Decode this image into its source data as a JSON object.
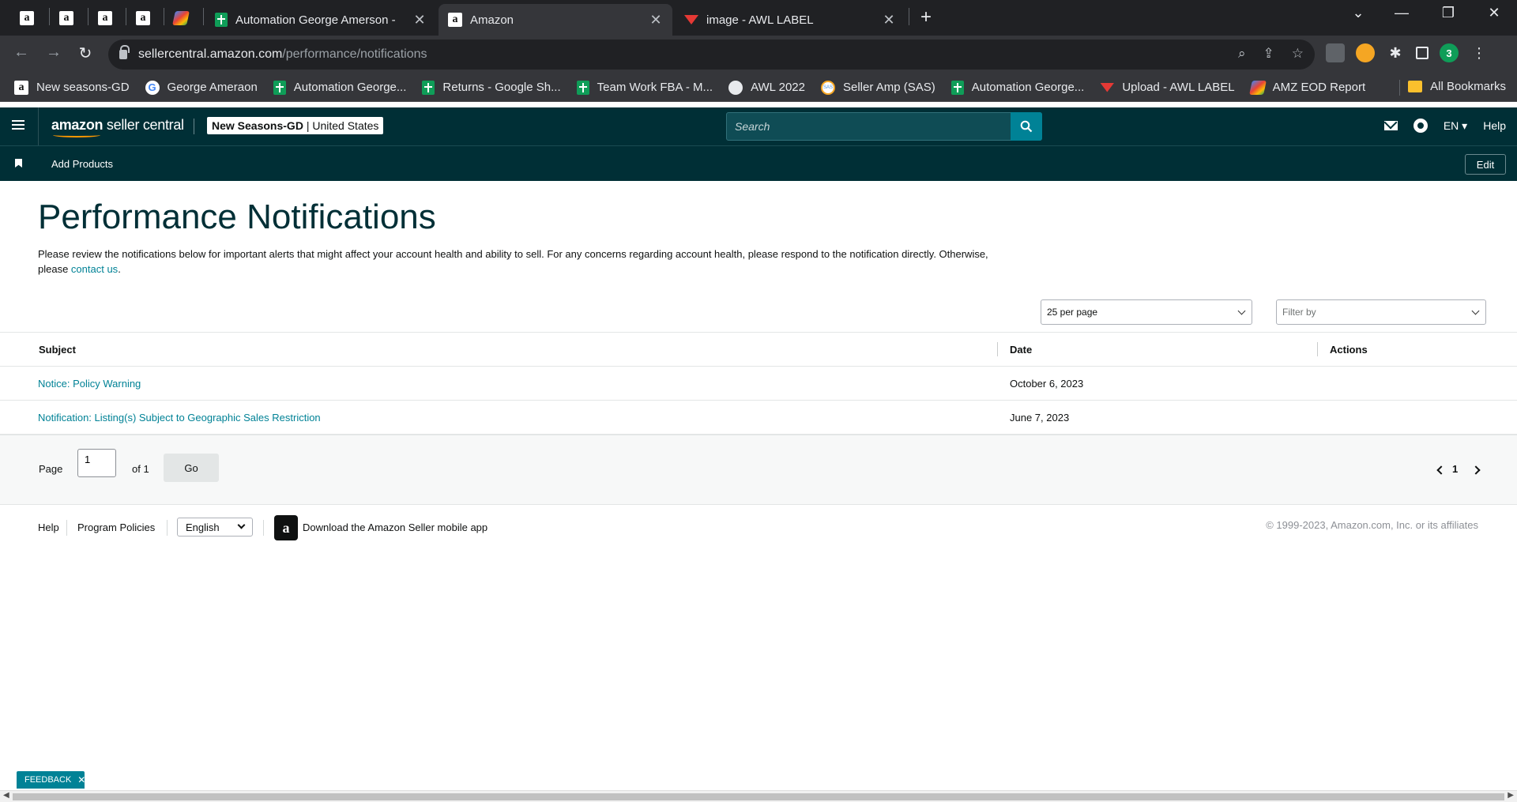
{
  "browser": {
    "tabs": [
      {
        "title": "Automation George Amerson - ",
        "close": "✕"
      },
      {
        "title": "Amazon",
        "close": "✕"
      },
      {
        "title": "image - AWL LABEL",
        "close": "✕"
      }
    ],
    "new_tab": "+",
    "url_host": "sellercentral.amazon.com",
    "url_path": "/performance/notifications",
    "window": {
      "minimize": "—",
      "maximize": "❐",
      "close": "✕",
      "tab_search": "⌄"
    },
    "profile_badge": "3",
    "bookmarks": [
      {
        "label": "New seasons-GD",
        "icon": "amazon-icon"
      },
      {
        "label": "George Ameraon",
        "icon": "google-icon"
      },
      {
        "label": "Automation George...",
        "icon": "sheets-icon"
      },
      {
        "label": "Returns - Google Sh...",
        "icon": "sheets-icon"
      },
      {
        "label": "Team Work FBA - M...",
        "icon": "sheets-icon"
      },
      {
        "label": "AWL 2022",
        "icon": "globe-icon"
      },
      {
        "label": "Seller Amp (SAS)",
        "icon": "sas-icon"
      },
      {
        "label": "Automation George...",
        "icon": "sheets-icon"
      },
      {
        "label": "Upload - AWL LABEL",
        "icon": "awl-icon"
      },
      {
        "label": "AMZ EOD Report",
        "icon": "pencil-icon"
      }
    ],
    "all_bookmarks": "All Bookmarks"
  },
  "header": {
    "logo_brand": "amazon",
    "logo_rest": " seller central",
    "store_name": "New Seasons-GD",
    "store_region": " | United States",
    "search_placeholder": "Search",
    "lang": "EN ▾",
    "help": "Help"
  },
  "nav": {
    "items": [
      "Add Products"
    ],
    "edit": "Edit"
  },
  "main": {
    "title": "Performance Notifications",
    "intro_text": "Please review the notifications below for important alerts that might affect your account health and ability to sell. For any concerns regarding account health, please respond to the notification directly. Otherwise, please ",
    "intro_link": "contact us",
    "intro_end": ".",
    "per_page": "25 per page",
    "filter_placeholder": "Filter by",
    "columns": {
      "subject": "Subject",
      "date": "Date",
      "actions": "Actions"
    },
    "rows": [
      {
        "subject": "Notice: Policy Warning",
        "date": "October 6, 2023"
      },
      {
        "subject": "Notification: Listing(s) Subject to Geographic Sales Restriction",
        "date": "June 7, 2023"
      }
    ],
    "pagination": {
      "page_label": "Page",
      "page_value": "1",
      "of_label": "of 1",
      "go": "Go",
      "current": "1"
    }
  },
  "footer": {
    "help": "Help",
    "policies": "Program Policies",
    "language": "English",
    "app_text": "Download the Amazon Seller mobile app",
    "copyright": "© 1999-2023, Amazon.com, Inc. or its affiliates"
  },
  "feedback": {
    "label": "FEEDBACK",
    "close": "✕"
  },
  "colors": {
    "header_bg": "#002f36",
    "accent": "#008296",
    "link": "#008296"
  }
}
